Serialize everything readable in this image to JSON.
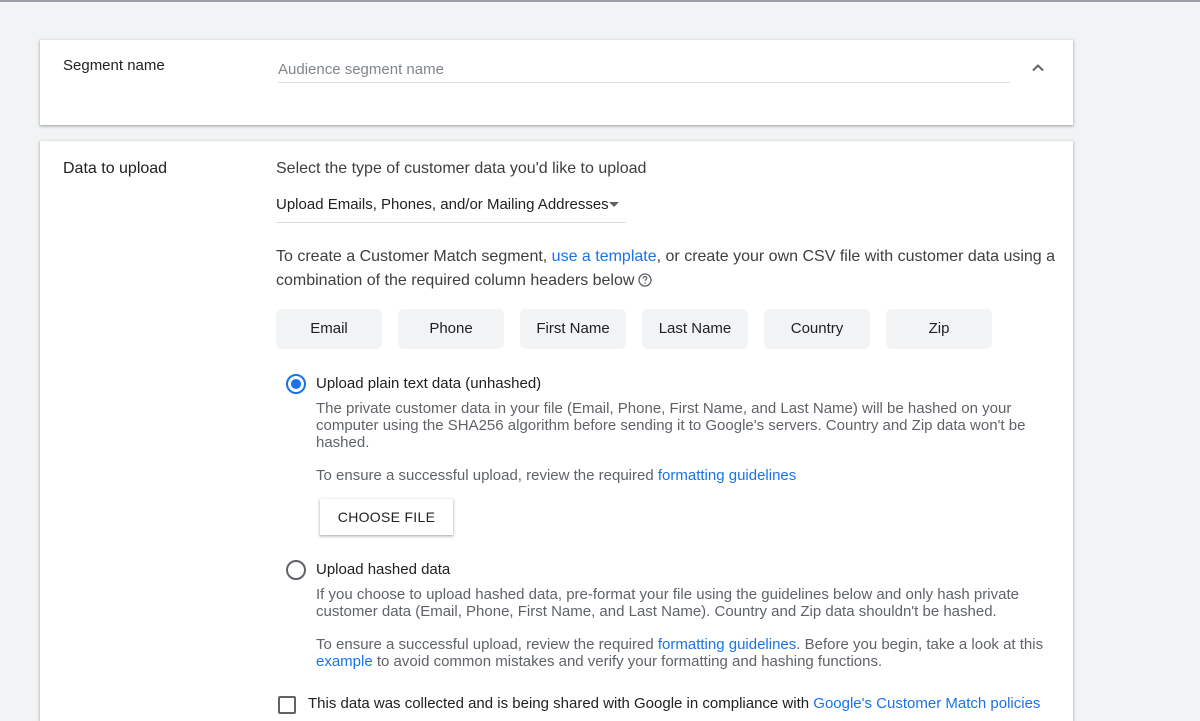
{
  "segment_name": {
    "label": "Segment name",
    "placeholder": "Audience segment name"
  },
  "data_upload": {
    "label": "Data to upload",
    "heading": "Select the type of customer data you'd like to upload",
    "dropdown_value": "Upload Emails, Phones, and/or Mailing Addresses",
    "intro_before": "To create a Customer Match segment, ",
    "intro_link": "use a template",
    "intro_after": ", or create your own CSV file with customer data using a combination of the required column headers below",
    "columns": [
      "Email",
      "Phone",
      "First Name",
      "Last Name",
      "Country",
      "Zip"
    ],
    "option_plain": {
      "title": "Upload plain text data (unhashed)",
      "description": "The private customer data in your file (Email, Phone, First Name, and Last Name) will be hashed on your computer using the SHA256 algorithm before sending it to Google's servers. Country and Zip data won't be hashed.",
      "guideline_before": "To ensure a successful upload, review the required ",
      "guideline_link": "formatting guidelines",
      "choose_file": "CHOOSE FILE"
    },
    "option_hashed": {
      "title": "Upload hashed data",
      "description": "If you choose to upload hashed data, pre-format your file using the guidelines below and only hash private customer data (Email, Phone, First Name, and Last Name). Country and Zip data shouldn't be hashed.",
      "guideline_before": "To ensure a successful upload, review the required ",
      "guideline_link": "formatting guidelines",
      "guideline_mid": ". Before you begin, take a look at this ",
      "example_link": "example",
      "guideline_after": " to avoid common mistakes and verify your formatting and hashing functions."
    },
    "consent_text": "This data was collected and is being shared with Google in compliance with ",
    "consent_link": "Google's Customer Match policies"
  },
  "colors": {
    "link": "#1a73e8",
    "radio_selected": "#1a73e8",
    "chip_bg": "#f1f3f4"
  }
}
